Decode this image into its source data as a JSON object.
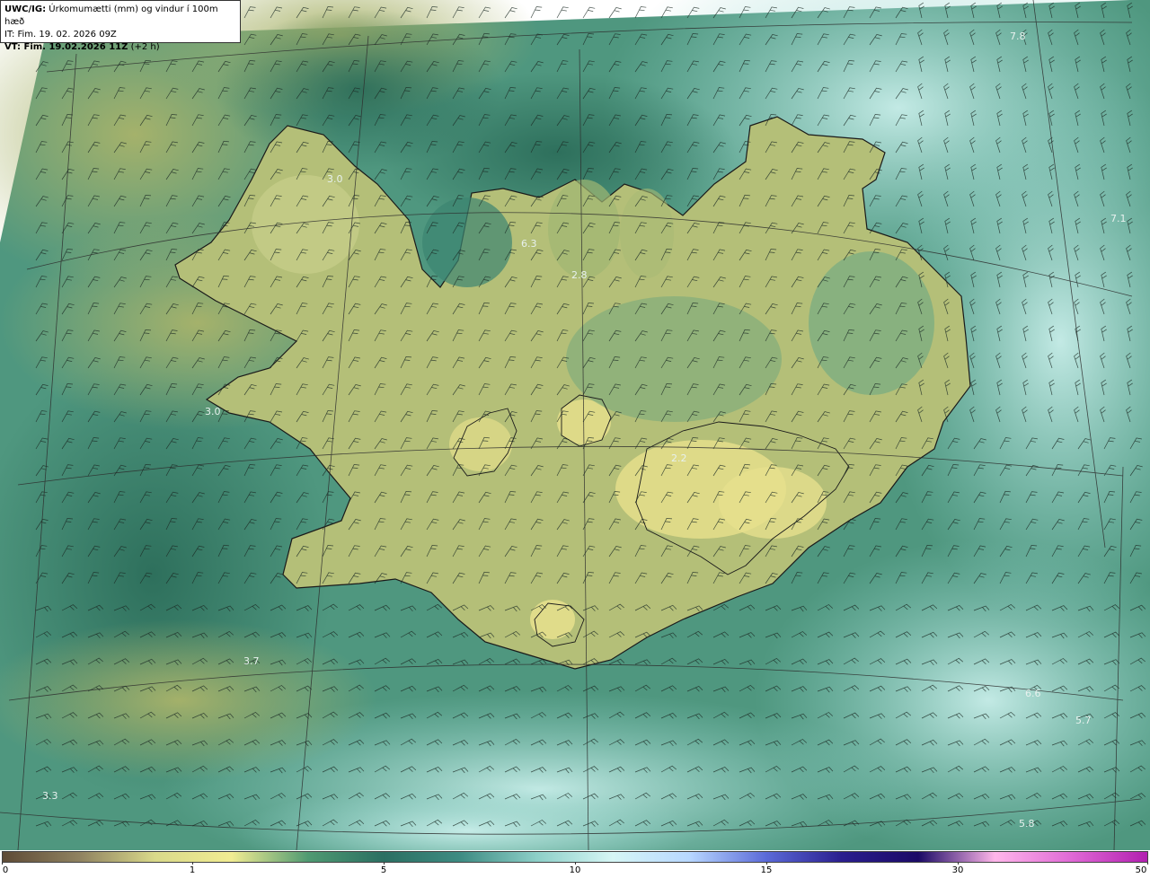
{
  "header": {
    "model": "UWC/IG:",
    "description": "Úrkomumætti (mm) og vindur í 100m hæð",
    "issue_time": "IT: Fim. 19. 02. 2026 09Z",
    "valid_time_label": "VT: Fim. 19.02.2026 11Z",
    "lead_time": "(+2 h)"
  },
  "colorbar": {
    "ticks": [
      "0",
      "1",
      "5",
      "10",
      "15",
      "30",
      "50"
    ],
    "colors": [
      "#5e4b36",
      "#8f8260",
      "#d9d98a",
      "#f1ec92",
      "#4f9a72",
      "#2b6f62",
      "#3e8c83",
      "#8dcfc8",
      "#d6f6f5",
      "#b7d7ff",
      "#5b6ad8",
      "#2a1e8e",
      "#1b0a66",
      "#ffb6ea",
      "#e06ad6",
      "#b21fb0"
    ]
  },
  "map": {
    "precip_labels": [
      "3.0",
      "6.3",
      "2.8",
      "3.0",
      "7.8",
      "7.1",
      "3.7",
      "6.6",
      "5.7",
      "3.3",
      "5.8",
      "2.2"
    ],
    "land_color": "#c8cf87",
    "ocean_color": "#3f8f7e",
    "coast_color": "#1c1c1c"
  }
}
